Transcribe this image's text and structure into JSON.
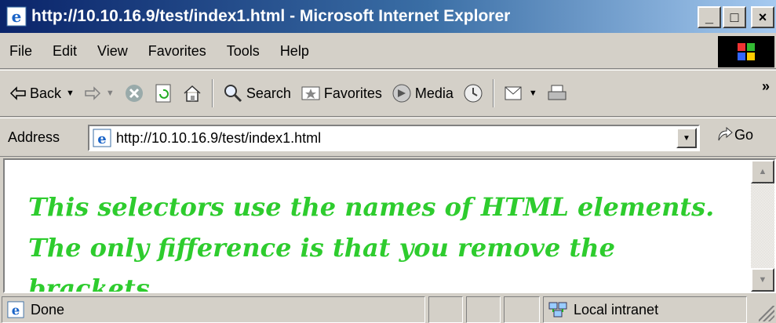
{
  "window": {
    "title": "http://10.10.16.9/test/index1.html - Microsoft Internet Explorer",
    "caption_buttons": {
      "minimize": "_",
      "maximize": "□",
      "close": "×"
    }
  },
  "menubar": {
    "items": [
      "File",
      "Edit",
      "View",
      "Favorites",
      "Tools",
      "Help"
    ]
  },
  "toolbar": {
    "back_label": "Back",
    "search_label": "Search",
    "favorites_label": "Favorites",
    "media_label": "Media",
    "more": "»"
  },
  "addressbar": {
    "label": "Address",
    "url": "http://10.10.16.9/test/index1.html",
    "go_label": "Go"
  },
  "content": {
    "text": "This selectors use the names of HTML elements. The only fifference is that you remove the brackets.",
    "text_color": "#2ecc2e"
  },
  "statusbar": {
    "status_text": "Done",
    "zone_text": "Local intranet"
  },
  "colors": {
    "titlebar_start": "#0a246a",
    "titlebar_end": "#a6caf0",
    "chrome": "#d4d0c8"
  }
}
